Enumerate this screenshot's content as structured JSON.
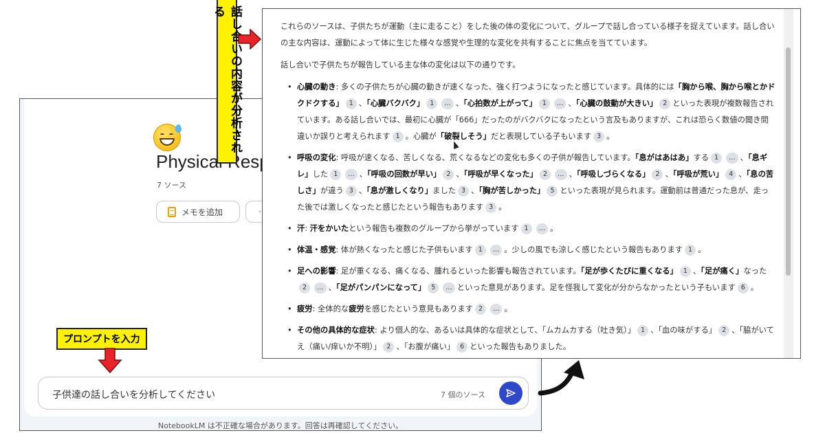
{
  "back_window": {
    "notebook_title": "Physical Resp",
    "source_count": "7 ソース",
    "memo_button_label": "メモを追加",
    "audio_button_label": "·I",
    "prompt_text": "子供達の話し合いを分析してください",
    "prompt_sources": "7 個のソース",
    "disclaimer": "NotebookLM は不正確な場合があります。回答は再確認してください。"
  },
  "annotations": {
    "vertical_callout": "話し合いの内容が分析される",
    "prompt_callout": "プロンプトを入力"
  },
  "response": {
    "intro_1": "これらのソースは、子供たちが運動（主に走ること）をした後の体の変化について、グループで話し合っている様子を捉えています。話し合いの主な内容は、運動によって体に生じた様々な感覚や生理的な変化を共有することに焦点を当てています。",
    "intro_2": "話し合いで子供たちが報告している主な体の変化は以下の通りです。",
    "b1": {
      "head": "心臓の動き",
      "t1": ": 多くの子供たちが心臓の動きが速くなった、強く打つようになったと感じています。具体的には",
      "q1": "「胸から喉、胸から喉とかドクドクする」",
      "c1": "1",
      "q2": "「心臓バクバク」",
      "c2": "1",
      "c3": "…",
      "q3": "「心拍数が上がって」",
      "c4": "1",
      "c5": "…",
      "q4": "「心臓の鼓動が大きい」",
      "c6": "2",
      "t2": "といった表現が複数報告されています。ある話し合いでは、最初に心臓が「666」だったのがバクバクになったという言及もありますが、これは恐らく数値の聞き間違いか誤りと考えられます",
      "c7": "1",
      "t3": "。心臓が",
      "q5": "「破裂しそう」",
      "t4": "だと表現している子もいます",
      "c8": "3",
      "t5": "。"
    },
    "b2": {
      "head": "呼吸の変化",
      "t1": ": 呼吸が速くなる、苦しくなる、荒くなるなどの変化も多くの子供が報告しています。",
      "q1": "「息がはあはあ」",
      "t2": "する",
      "c1": "1",
      "c2": "…",
      "t3": "、",
      "q2": "「息ギレ」",
      "t4": "した",
      "c3": "1",
      "c4": "…",
      "t5": "、",
      "q3": "「呼吸の回数が早い」",
      "c5": "2",
      "t6": "、",
      "q4": "「呼吸が早くなった」",
      "c6": "2",
      "c7": "…",
      "t7": "、",
      "q5": "「呼吸しづらくなる」",
      "c8": "2",
      "t8": "、",
      "q6": "「呼吸が荒い」",
      "c9": "4",
      "t9": "、",
      "q7": "「息の苦しさ」",
      "t10": "が違う",
      "c10": "3",
      "t11": "、",
      "q8": "「息が激しくなり」",
      "t12": "ました",
      "c11": "3",
      "t13": "、",
      "q9": "「胸が苦しかった」",
      "c12": "5",
      "t14": "といった表現が見られます。運動前は普通だった息が、走った後では激しくなったと感じたという報告もあります",
      "c13": "3",
      "t15": "。"
    },
    "b3": {
      "head": "汗",
      "t1": ": ",
      "q1": "汗をかいた",
      "t2": "という報告も複数のグループから挙がっています",
      "c1": "1",
      "c2": "…",
      "t3": "。"
    },
    "b4": {
      "head": "体温・感覚",
      "t1": ": 体が熱くなったと感じた子供もいます",
      "c1": "1",
      "c2": "…",
      "t2": "。少しの風でも涼しく感じたという報告もあります",
      "c3": "1",
      "t3": "。"
    },
    "b5": {
      "head": "足への影響",
      "t1": ": 足が重くなる、痛くなる、腫れるといった影響も報告されています。",
      "q1": "「足が歩くたびに重くなる」",
      "c1": "1",
      "t2": "、",
      "q2": "「足が痛く」",
      "t3": "なった",
      "c2": "2",
      "c3": "…",
      "t4": "、",
      "q3": "「足がパンパンになって」",
      "c4": "5",
      "c5": "…",
      "t5": "といった意見があります。足を怪我して変化が分からなかったという子もいます",
      "c6": "6",
      "t6": "。"
    },
    "b6": {
      "head": "疲労",
      "t1": ": 全体的な",
      "q1": "疲労",
      "t2": "を感じたという意見もあります",
      "c1": "2",
      "c2": "…",
      "t3": "。"
    },
    "b7": {
      "head": "その他の具体的な症状",
      "t1": ": より個人的な、あるいは具体的な症状として、「ムカムカする（吐き気）」",
      "c1": "1",
      "t2": "、「血の味がする」",
      "c2": "2",
      "t3": "、「脇がいてえ（痛い/痒いか不明）」",
      "c3": "2",
      "t4": "、「お腹が痛い」",
      "c4": "6",
      "t5": "といった報告もありました。"
    }
  }
}
